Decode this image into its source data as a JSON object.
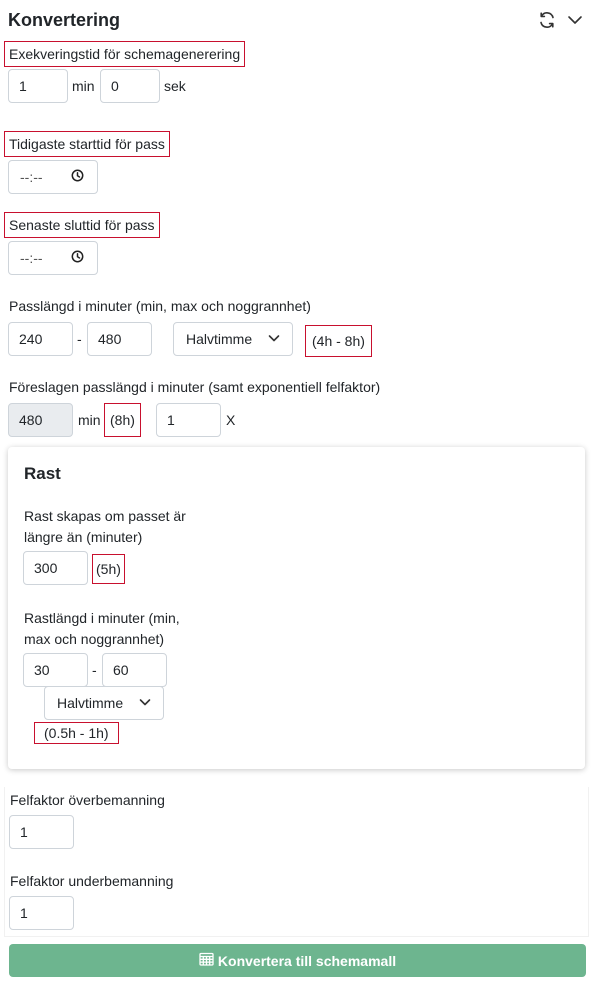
{
  "header": {
    "title": "Konvertering",
    "refresh_icon": "refresh-icon",
    "collapse_icon": "chevron-down-icon"
  },
  "exec": {
    "label": "Exekveringstid för schemagenerering",
    "min_value": "1",
    "min_unit": "min",
    "sec_value": "0",
    "sec_unit": "sek"
  },
  "earliest": {
    "label": "Tidigaste starttid för pass",
    "value": "--:--",
    "icon": "clock-icon"
  },
  "latest": {
    "label": "Senaste sluttid för pass",
    "value": "--:--",
    "icon": "clock-icon"
  },
  "shift_length": {
    "label": "Passlängd i minuter (min, max och noggrannhet)",
    "min": "240",
    "sep": "-",
    "max": "480",
    "precision": "Halvtimme",
    "range_hint": "(4h - 8h)"
  },
  "suggested": {
    "label": "Föreslagen passlängd i minuter (samt exponentiell felfaktor)",
    "value": "480",
    "unit": "min",
    "hours_hint": "(8h)",
    "factor": "1",
    "factor_unit": "X"
  },
  "rast": {
    "title": "Rast",
    "threshold_label_line1": "Rast skapas om passet är",
    "threshold_label_line2": "längre än (minuter)",
    "threshold_value": "300",
    "threshold_hint": "(5h)",
    "length_label_line1": "Rastlängd i minuter (min,",
    "length_label_line2": "max och noggrannhet)",
    "min": "30",
    "sep": "-",
    "max": "60",
    "precision": "Halvtimme",
    "range_hint": "(0.5h - 1h)"
  },
  "overstaff": {
    "label": "Felfaktor överbemanning",
    "value": "1"
  },
  "understaff": {
    "label": "Felfaktor underbemanning",
    "value": "1"
  },
  "convert_button": {
    "label": "Konvertera till schemamall",
    "icon": "calendar-icon"
  },
  "colors": {
    "accent_button": "#6db58f",
    "highlight_border": "#c8102e"
  }
}
